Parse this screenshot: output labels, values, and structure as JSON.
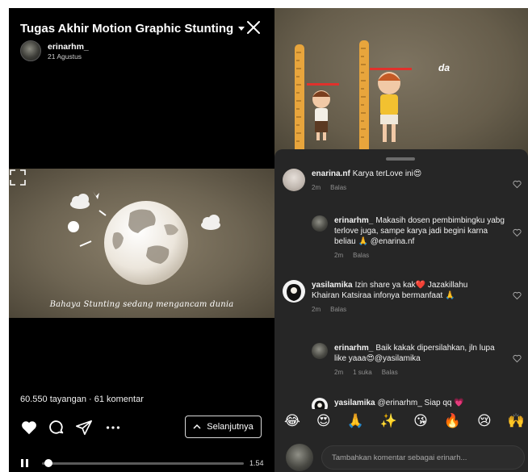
{
  "left_panel": {
    "title": "Tugas Akhir Motion Graphic Stunting",
    "author": {
      "name": "erinarhm_",
      "date": "21 Agustus"
    },
    "video_caption": "Bahaya Stunting sedang mengancam dunia",
    "stats": "60.550 tayangan · 61 komentar",
    "next_label": "Selanjutnya",
    "time": "1.54",
    "progress_fraction": 0.03,
    "icons": {
      "close": "close-icon",
      "dropdown": "chevron-down-icon",
      "like": "heart-icon",
      "comment": "comment-icon",
      "share": "send-icon",
      "more": "more-icon",
      "fullscreen": "fullscreen-icon",
      "pause": "pause-icon"
    }
  },
  "right_panel": {
    "scene_text": "da",
    "comments": [
      {
        "user": "enarina.nf",
        "text": "Karya terLove ini😍",
        "time": "2m",
        "reply": "Balas",
        "likes": ""
      },
      {
        "user": "erinarhm_",
        "text": "Makasih dosen pembimbingku yabg terlove juga, sampe karya jadi begini karna beliau 🙏 @enarina.nf",
        "time": "2m",
        "reply": "Balas",
        "likes": ""
      },
      {
        "user": "yasilamika",
        "text": "Izin share ya kak❤️ Jazakillahu Khairan Katsiraa infonya bermanfaat 🙏",
        "time": "2m",
        "reply": "Balas",
        "likes": ""
      },
      {
        "user": "erinarhm_",
        "text": "Baik kakak dipersilahkan, jln lupa like yaaa😍@yasilamika",
        "time": "2m",
        "reply": "Balas",
        "likes": "1 suka"
      },
      {
        "user": "yasilamika",
        "text": "@erinarhm_ Siap qq 💗",
        "time": "",
        "reply": "",
        "likes": ""
      }
    ],
    "emojis": [
      "😂",
      "😍",
      "🙏",
      "✨",
      "😘",
      "🔥",
      "😢",
      "🙌"
    ],
    "composer_placeholder": "Tambahkan komentar sebagai erinarh..."
  }
}
